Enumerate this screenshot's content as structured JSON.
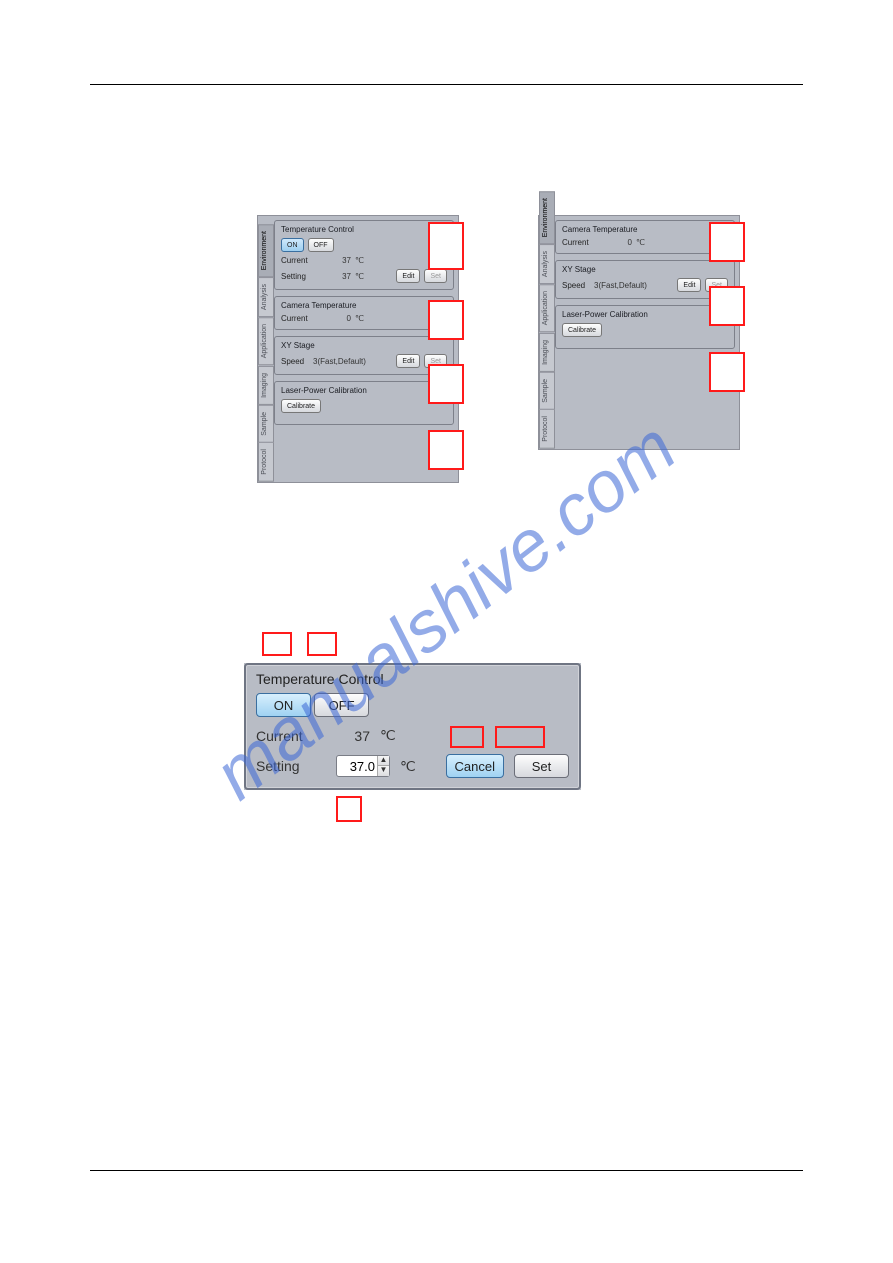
{
  "tabs": [
    "Protocol",
    "Sample",
    "Imaging",
    "Application",
    "Analysis",
    "Environment"
  ],
  "activeTab": "Environment",
  "groups": {
    "tempControl": {
      "title": "Temperature Control",
      "on": "ON",
      "off": "OFF",
      "currentLabel": "Current",
      "currentValue": "37",
      "currentUnit": "℃",
      "settingLabel": "Setting",
      "settingValue": "37",
      "settingUnit": "℃",
      "editBtn": "Edit",
      "setBtn": "Set"
    },
    "cameraTemp": {
      "title": "Camera Temperature",
      "currentLabel": "Current",
      "currentValue": "0",
      "currentUnit": "℃"
    },
    "xyStage": {
      "title": "XY Stage",
      "speedLabel": "Speed",
      "speedValue": "3(Fast,Default)",
      "editBtn": "Edit",
      "setBtn": "Set"
    },
    "laserCal": {
      "title": "Laser-Power Calibration",
      "calibrateBtn": "Calibrate"
    }
  },
  "detail": {
    "title": "Temperature Control",
    "on": "ON",
    "off": "OFF",
    "currentLabel": "Current",
    "currentValue": "37",
    "unit": "℃",
    "settingLabel": "Setting",
    "settingValue": "37.0",
    "cancel": "Cancel",
    "set": "Set"
  },
  "watermark": "manualshive.com"
}
